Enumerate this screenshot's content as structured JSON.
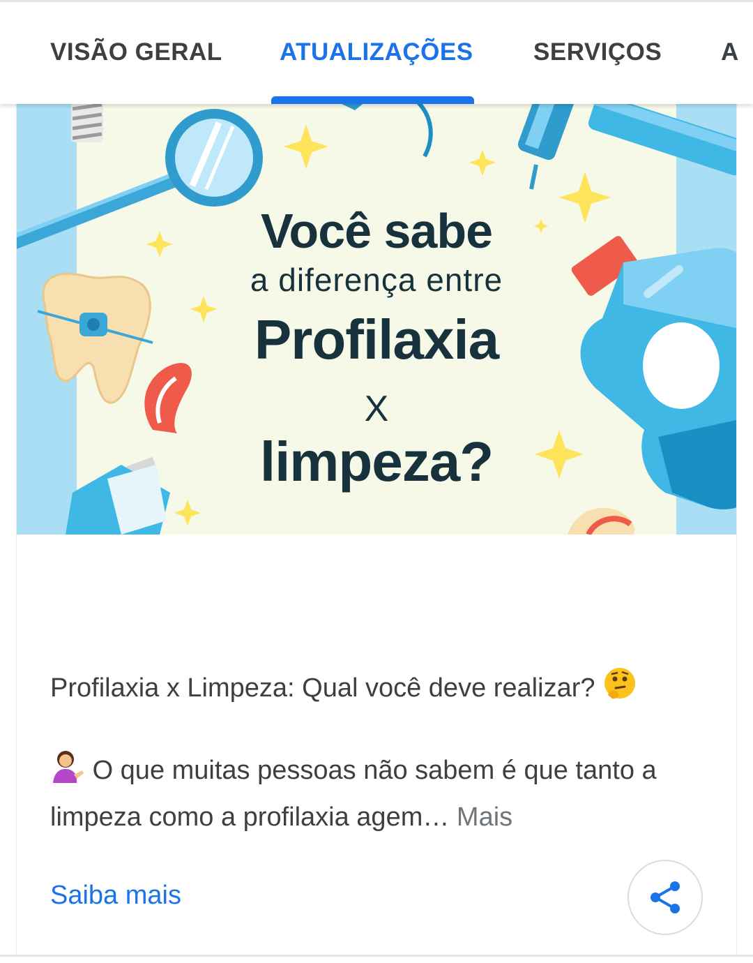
{
  "tabs": [
    {
      "label": "VISÃO GERAL",
      "active": false
    },
    {
      "label": "ATUALIZAÇÕES",
      "active": true
    },
    {
      "label": "SERVIÇOS",
      "active": false
    },
    {
      "label": "A",
      "active": false
    }
  ],
  "colors": {
    "accent": "#1a73e8",
    "text": "#3c4043",
    "muted": "#70757a",
    "banner_bg": "#f6f9e8",
    "banner_side": "#a9def5"
  },
  "post": {
    "image": {
      "line1": "Você sabe",
      "line2": "a diferença entre",
      "line3": "Profilaxia",
      "line4": "X",
      "line5": "limpeza?"
    },
    "title": "Profilaxia x Limpeza: Qual você deve realizar?",
    "title_icon": "thinking-face-icon",
    "body": "O que muitas pessoas não sabem é que tanto a limpeza como a profilaxia agem…",
    "body_icon": "person-tipping-hand-icon",
    "more_label": "Mais",
    "learn_more_label": "Saiba mais",
    "share_icon": "share-icon"
  }
}
